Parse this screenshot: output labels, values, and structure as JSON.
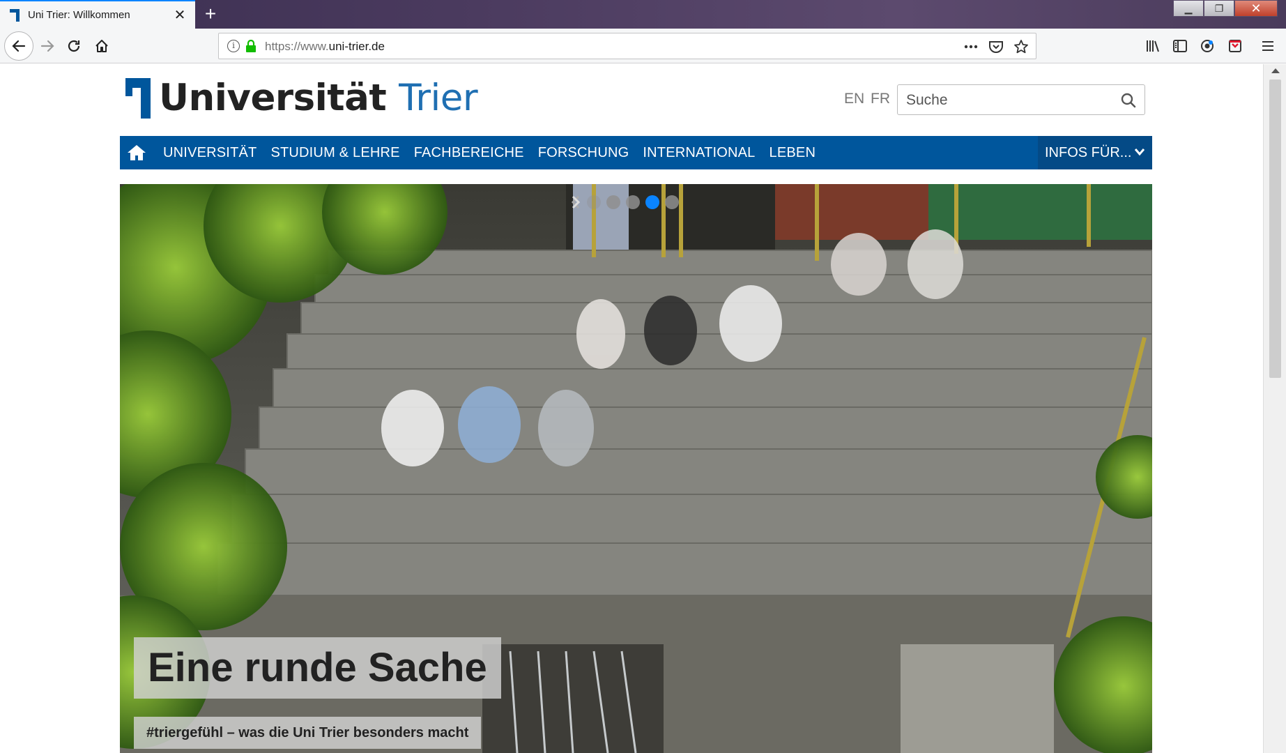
{
  "browser": {
    "tab_title": "Uni Trier: Willkommen",
    "new_tab_glyph": "+",
    "close_glyph": "✕",
    "url_prefix": "https://www.",
    "url_domain": "uni-trier.de",
    "win_minimize": "▁",
    "win_restore": "❐",
    "win_close": "✕",
    "accent": "#0a84ff"
  },
  "header": {
    "logo_word1": "Universität",
    "logo_word2": "Trier",
    "lang_en": "EN",
    "lang_fr": "FR",
    "search_placeholder": "Suche"
  },
  "nav": {
    "items": [
      "UNIVERSITÄT",
      "STUDIUM & LEHRE",
      "FACHBEREICHE",
      "FORSCHUNG",
      "INTERNATIONAL",
      "LEBEN"
    ],
    "infos_label": "INFOS FÜR...",
    "bg_color": "#00569c"
  },
  "hero": {
    "slide_count": 5,
    "active_slide": 4,
    "title": "Eine runde Sache",
    "subtitle": "#triergefühl – was die Uni Trier besonders macht"
  },
  "icons": [
    "back-arrow-icon",
    "forward-arrow-icon",
    "reload-icon",
    "home-icon",
    "info-icon",
    "lock-icon",
    "more-icon",
    "pocket-icon",
    "star-icon",
    "library-icon",
    "sidebar-icon",
    "sync-icon",
    "extension-icon",
    "menu-icon",
    "search-icon",
    "chevron-down-icon"
  ]
}
